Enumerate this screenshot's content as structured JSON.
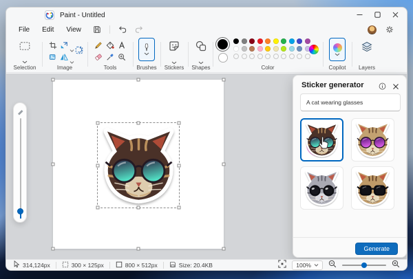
{
  "window": {
    "title": "Paint - Untitled"
  },
  "menu": {
    "items": [
      "File",
      "Edit",
      "View"
    ]
  },
  "ribbon": {
    "groups": [
      {
        "label": "Selection"
      },
      {
        "label": "Image"
      },
      {
        "label": "Tools"
      },
      {
        "label": "Brushes"
      },
      {
        "label": "Stickers"
      },
      {
        "label": "Shapes"
      },
      {
        "label": "Color"
      },
      {
        "label": "Copilot"
      },
      {
        "label": "Layers"
      }
    ],
    "palette": {
      "primary": "#000000",
      "secondary": "#FFFFFF",
      "row1": [
        "#000000",
        "#7F7F7F",
        "#880015",
        "#ED1C24",
        "#FF7F27",
        "#FFF200",
        "#22B14C",
        "#00A2E8",
        "#3F48CC",
        "#A349A4"
      ],
      "row2": [
        "#FFFFFF",
        "#C3C3C3",
        "#B97A57",
        "#FFAEC9",
        "#FFC90E",
        "#EFE4B0",
        "#B5E61D",
        "#99D9EA",
        "#7092BE",
        "#C8BFE7"
      ],
      "empty_count": 10
    }
  },
  "sticker_panel": {
    "title": "Sticker generator",
    "prompt": "A cat wearing glasses",
    "generate_label": "Generate",
    "accent": "#0F6CBD",
    "thumbnails": [
      {
        "name": "cat-teal-aviators",
        "selected": true,
        "fur": "#4a3128",
        "streaks": "#c79a62",
        "muzzle": "#e9d9ba",
        "glasses": "aviator",
        "lens_a": "#2a2342",
        "lens_b": "#52e2c6",
        "glow": "#ee6fd8"
      },
      {
        "name": "cat-purple-aviators",
        "selected": false,
        "fur": "#c3a271",
        "streaks": "#5c3c26",
        "muzzle": "#ecdfc2",
        "glasses": "aviator",
        "lens_a": "#52106e",
        "lens_b": "#da5fe8",
        "glow": ""
      },
      {
        "name": "cat-gray-round-glasses",
        "selected": false,
        "fur": "#a9a9b3",
        "streaks": "#55555f",
        "muzzle": "#dddde3",
        "glasses": "round",
        "lens_a": "#17171d",
        "lens_b": "#2a2a33",
        "glow": ""
      },
      {
        "name": "cat-tabby-thick-glasses",
        "selected": false,
        "fur": "#bf9a68",
        "streaks": "#54331d",
        "muzzle": "#ecdfc2",
        "glasses": "thick",
        "lens_a": "#121217",
        "lens_b": "#26262e",
        "glow": ""
      }
    ]
  },
  "canvas": {
    "sticker": "cat-teal-aviators"
  },
  "status_bar": {
    "items": [
      {
        "icon": "cursor-position-icon",
        "text": "314,124px"
      },
      {
        "icon": "selection-size-icon",
        "text": "300 × 125px"
      },
      {
        "icon": "canvas-size-icon",
        "text": "800 × 512px"
      },
      {
        "icon": "file-size-icon",
        "text": "Size: 20.4KB"
      }
    ],
    "zoom_value": "100%"
  }
}
